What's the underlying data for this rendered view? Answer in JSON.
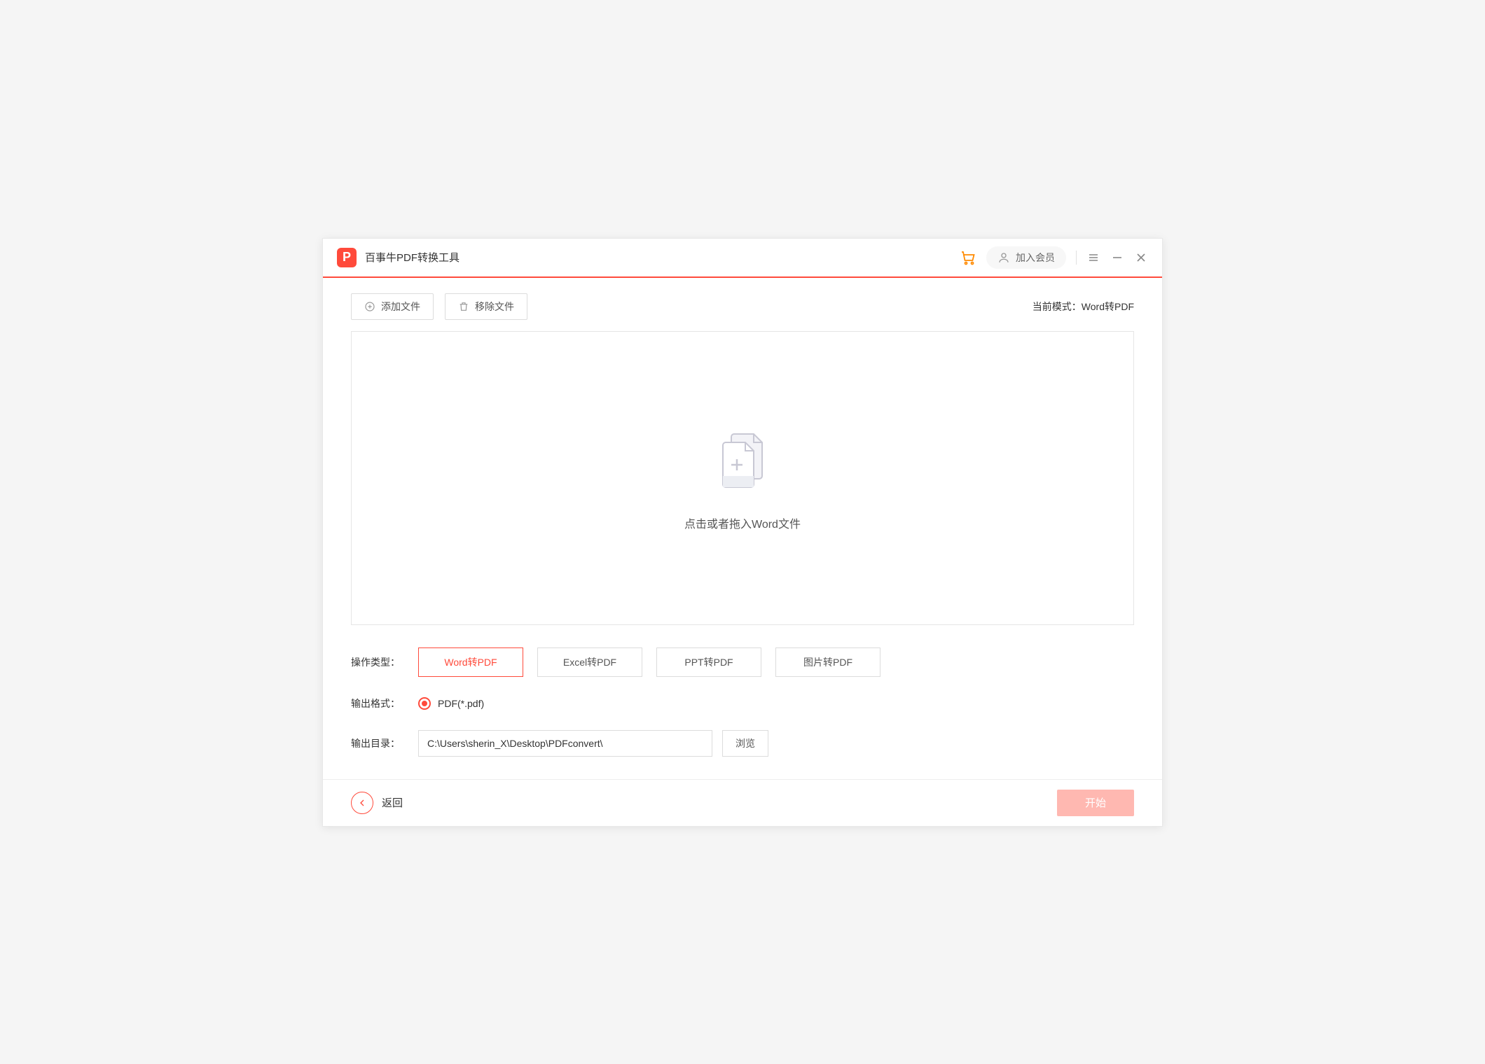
{
  "header": {
    "app_title": "百事牛PDF转换工具",
    "member_label": "加入会员"
  },
  "toolbar": {
    "add_file_label": "添加文件",
    "remove_file_label": "移除文件",
    "mode_prefix": "当前模式：",
    "mode_value": "Word转PDF"
  },
  "dropzone": {
    "hint": "点击或者拖入Word文件"
  },
  "options": {
    "type_label": "操作类型：",
    "types": [
      {
        "label": "Word转PDF",
        "active": true
      },
      {
        "label": "Excel转PDF",
        "active": false
      },
      {
        "label": "PPT转PDF",
        "active": false
      },
      {
        "label": "图片转PDF",
        "active": false
      }
    ],
    "format_label": "输出格式：",
    "format_value": "PDF(*.pdf)",
    "output_label": "输出目录：",
    "output_path": "C:\\Users\\sherin_X\\Desktop\\PDFconvert\\",
    "browse_label": "浏览"
  },
  "footer": {
    "back_label": "返回",
    "start_label": "开始"
  }
}
